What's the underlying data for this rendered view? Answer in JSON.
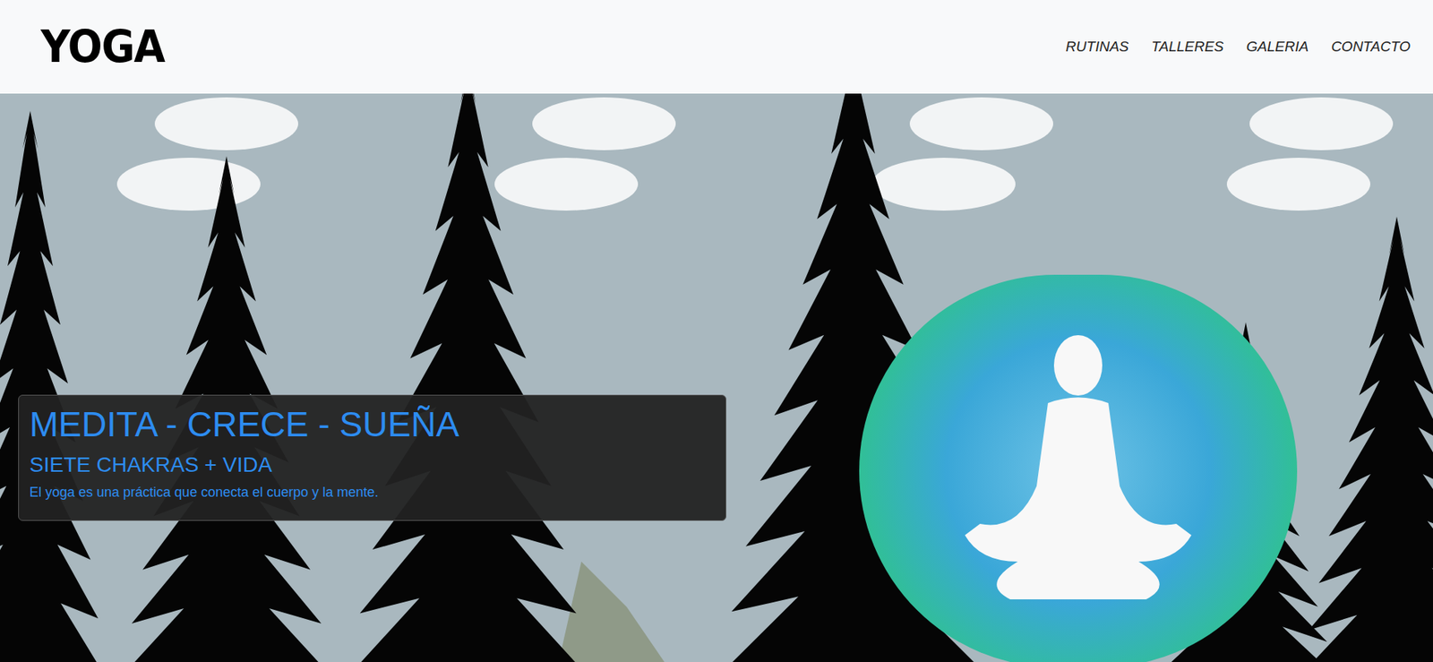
{
  "header": {
    "logo": "YOGA",
    "nav": [
      {
        "label": "RUTINAS"
      },
      {
        "label": "TALLERES"
      },
      {
        "label": "GALERIA"
      },
      {
        "label": "CONTACTO"
      }
    ]
  },
  "hero": {
    "title": "MEDITA - CRECE - SUEÑA",
    "subtitle": "SIETE CHAKRAS + VIDA",
    "text": "El yoga es una práctica que conecta el cuerpo y la mente."
  }
}
